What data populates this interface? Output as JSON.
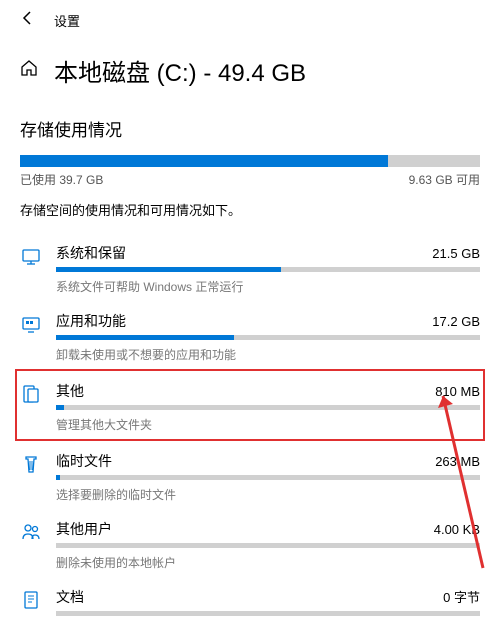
{
  "header": {
    "settings_label": "设置",
    "page_title": "本地磁盘 (C:) - 49.4 GB"
  },
  "storage": {
    "section_title": "存储使用情况",
    "used_label": "已使用 39.7 GB",
    "free_label": "9.63 GB 可用",
    "used_percent": 80,
    "description": "存储空间的使用情况和可用情况如下。"
  },
  "categories": [
    {
      "name": "系统和保留",
      "size": "21.5 GB",
      "desc": "系统文件可帮助 Windows 正常运行",
      "fill": 53,
      "highlighted": false,
      "icon": "system"
    },
    {
      "name": "应用和功能",
      "size": "17.2 GB",
      "desc": "卸载未使用或不想要的应用和功能",
      "fill": 42,
      "highlighted": false,
      "icon": "apps"
    },
    {
      "name": "其他",
      "size": "810 MB",
      "desc": "管理其他大文件夹",
      "fill": 2,
      "highlighted": true,
      "icon": "other"
    },
    {
      "name": "临时文件",
      "size": "263 MB",
      "desc": "选择要删除的临时文件",
      "fill": 1,
      "highlighted": false,
      "icon": "temp"
    },
    {
      "name": "其他用户",
      "size": "4.00 KB",
      "desc": "删除未使用的本地帐户",
      "fill": 0,
      "highlighted": false,
      "icon": "users"
    },
    {
      "name": "文档",
      "size": "0 字节",
      "desc": "",
      "fill": 0,
      "highlighted": false,
      "icon": "docs"
    }
  ]
}
